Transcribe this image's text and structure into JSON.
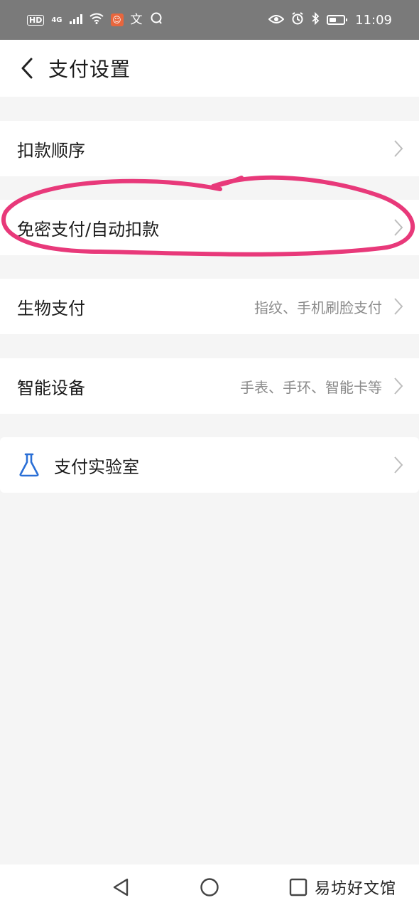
{
  "status_bar": {
    "hd": "HD",
    "network": "4G",
    "time": "11:09",
    "icons": [
      "signal-icon",
      "wifi-icon",
      "app-notification-icon",
      "translate-icon",
      "chat-icon",
      "eye-icon",
      "alarm-icon",
      "bluetooth-icon",
      "battery-icon"
    ]
  },
  "header": {
    "title": "支付设置",
    "back_icon": "chevron-left-icon"
  },
  "rows": [
    {
      "label": "扣款顺序",
      "sub": ""
    },
    {
      "label": "免密支付/自动扣款",
      "sub": ""
    },
    {
      "label": "生物支付",
      "sub": "指纹、手机刷脸支付"
    },
    {
      "label": "智能设备",
      "sub": "手表、手环、智能卡等"
    },
    {
      "label": "支付实验室",
      "sub": "",
      "icon": "flask-icon"
    }
  ],
  "annotation": {
    "color": "#e8397a"
  },
  "nav_bar": {
    "icons": [
      "back-triangle-icon",
      "home-circle-icon",
      "recents-square-icon"
    ]
  },
  "watermark": "易坊好文馆",
  "colors": {
    "accent_blue": "#2a6fd6",
    "background": "#f5f5f5",
    "status_bar": "#7a7a7a"
  }
}
